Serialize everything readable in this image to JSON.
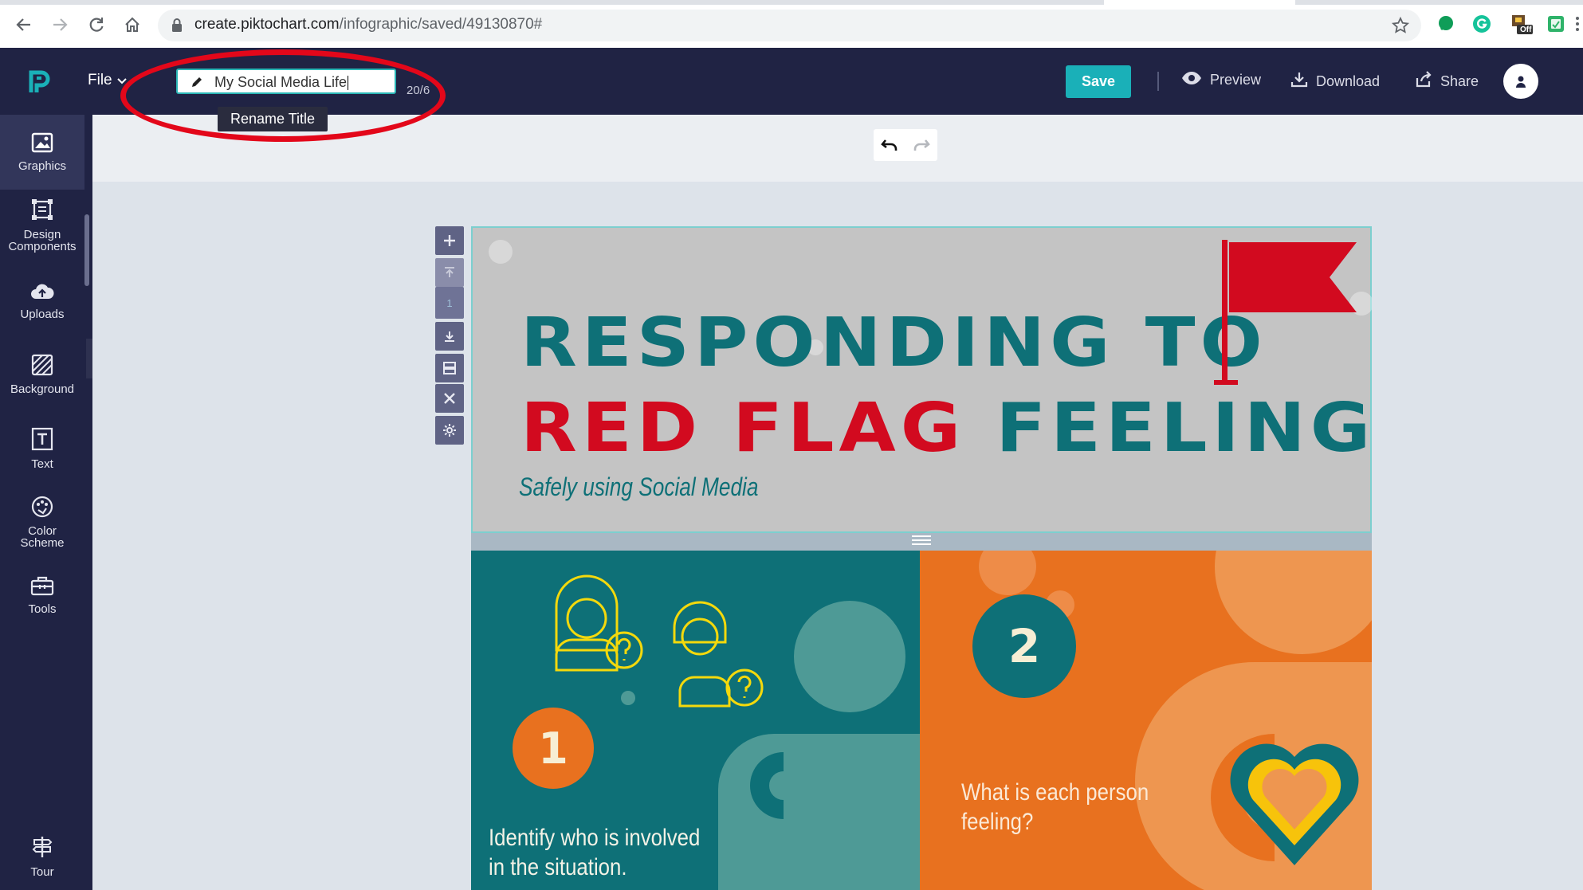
{
  "browser": {
    "url_host": "create.piktochart.com",
    "url_path": "/infographic/saved/49130870#",
    "extension_badge": "Off"
  },
  "appbar": {
    "file_label": "File",
    "title_value": "My Social Media Life",
    "char_count": "20/6",
    "tooltip": "Rename Title",
    "save_label": "Save",
    "preview_label": "Preview",
    "download_label": "Download",
    "share_label": "Share"
  },
  "sidebar": {
    "items": [
      {
        "label": "Graphics",
        "icon": "image-icon"
      },
      {
        "label": "Design Components",
        "icon": "design-components-icon"
      },
      {
        "label": "Uploads",
        "icon": "cloud-upload-icon"
      },
      {
        "label": "Background",
        "icon": "hatch-icon"
      },
      {
        "label": "Text",
        "icon": "text-icon"
      },
      {
        "label": "Color Scheme",
        "icon": "palette-icon"
      },
      {
        "label": "Tools",
        "icon": "toolbox-icon"
      },
      {
        "label": "Tour",
        "icon": "signpost-icon"
      }
    ]
  },
  "block_tools": {
    "page_number": "1"
  },
  "infographic": {
    "headline_line1": "RESPONDING TO",
    "headline_line2_red": "RED FLAG",
    "headline_line2_teal": "FEELINGS",
    "subtitle": "Safely using Social Media",
    "step1": {
      "number": "1",
      "text_line1": "Identify who is involved",
      "text_line2": "in the situation."
    },
    "step2": {
      "number": "2",
      "text_line1": "What is each person",
      "text_line2": "feeling?"
    }
  },
  "colors": {
    "app_navy": "#202344",
    "accent_teal": "#1ab0b8",
    "brand_teal": "#0e7077",
    "brand_red": "#d20a1f",
    "brand_orange": "#e8711f",
    "annotation_red": "#e3071a"
  }
}
